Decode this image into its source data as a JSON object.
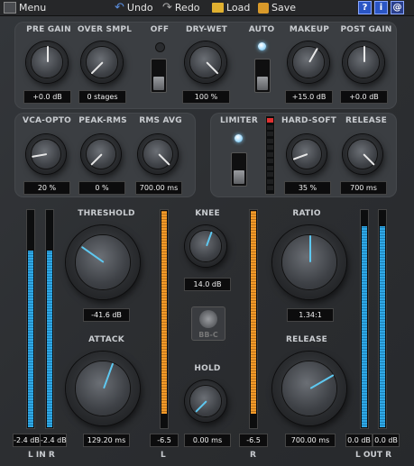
{
  "toolbar": {
    "menu_label": "Menu",
    "undo_label": "Undo",
    "redo_label": "Redo",
    "load_label": "Load",
    "save_label": "Save",
    "help_icon": "?",
    "info_icon": "i",
    "at_icon": "@"
  },
  "top": {
    "pre_gain": {
      "label": "PRE GAIN",
      "value": "+0.0 dB"
    },
    "over_smpl": {
      "label": "OVER SMPL",
      "value": "0 stages"
    },
    "off_switch": {
      "label": "OFF"
    },
    "dry_wet": {
      "label": "DRY-WET",
      "value": "100 %"
    },
    "auto_switch": {
      "label": "AUTO"
    },
    "makeup": {
      "label": "MAKEUP",
      "value": "+15.0 dB"
    },
    "post_gain": {
      "label": "POST GAIN",
      "value": "+0.0 dB"
    }
  },
  "mid": {
    "vca_opto": {
      "label": "VCA-OPTO",
      "value": "20 %"
    },
    "peak_rms": {
      "label": "PEAK-RMS",
      "value": "0 %"
    },
    "rms_avg": {
      "label": "RMS AVG",
      "value": "700.00 ms"
    },
    "limiter": {
      "label": "LIMITER"
    },
    "hard_soft": {
      "label": "HARD-SOFT",
      "value": "35 %"
    },
    "release_small": {
      "label": "RELEASE",
      "value": "700 ms"
    }
  },
  "main": {
    "threshold": {
      "label": "THRESHOLD",
      "value": "-41.6 dB"
    },
    "knee": {
      "label": "KNEE",
      "value": "14.0 dB"
    },
    "ratio": {
      "label": "RATIO",
      "value": "1.34:1"
    },
    "attack": {
      "label": "ATTACK",
      "value": "129.20 ms"
    },
    "hold": {
      "label": "HOLD",
      "value": "0.00 ms"
    },
    "release": {
      "label": "RELEASE",
      "value": "700.00 ms"
    },
    "logo_text": "BB-C"
  },
  "meters": {
    "in_l": {
      "value": "-2.4 dB",
      "level": 0.82
    },
    "in_r": {
      "value": "-2.4 dB",
      "level": 0.82
    },
    "in_label": "L IN R",
    "gr_l": {
      "value": "-6.5",
      "level": 0.94,
      "label": "L"
    },
    "gr_r": {
      "value": "-6.5",
      "level": 0.94,
      "label": "R"
    },
    "out_l": {
      "value": "0.0 dB",
      "level": 0.93
    },
    "out_r": {
      "value": "0.0 dB",
      "level": 0.93
    },
    "out_label": "L OUT R"
  },
  "colors": {
    "accent_blue": "#2fa8e6",
    "accent_orange": "#f39a28",
    "led_red": "#e03030"
  }
}
